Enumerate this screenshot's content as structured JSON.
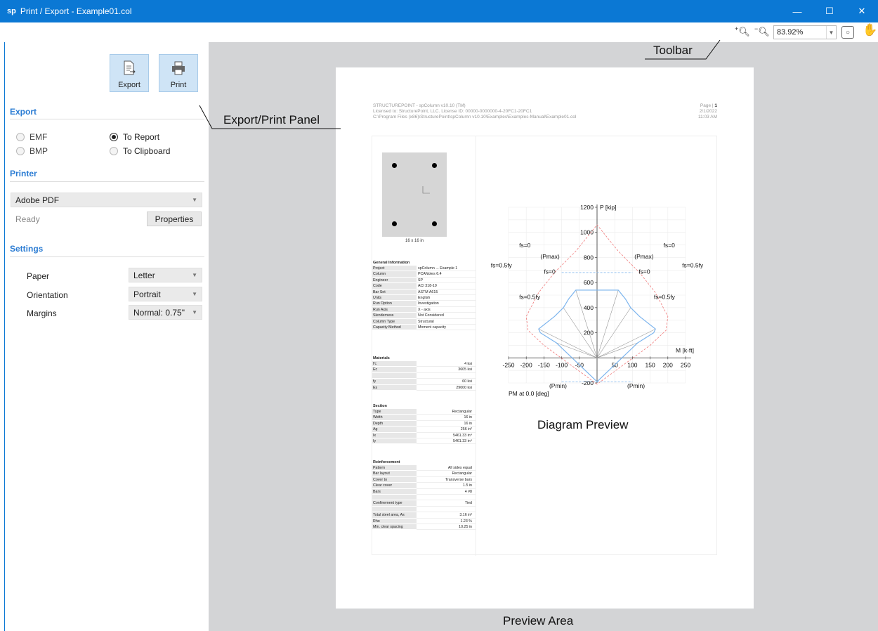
{
  "window": {
    "logo": "sp",
    "title": "Print / Export - Example01.col"
  },
  "toolbar": {
    "zoom_value": "83.92%",
    "zoom_in_icon": "zoom-in-icon",
    "zoom_out_icon": "zoom-out-icon",
    "fit_icon": "fit-page-icon",
    "hand_icon": "hand-pan-icon"
  },
  "panel": {
    "export_button": "Export",
    "print_button": "Print",
    "export_section": "Export",
    "export_options": {
      "emf": "EMF",
      "bmp": "BMP",
      "to_report": "To Report",
      "to_clipboard": "To Clipboard"
    },
    "selected_target": "To Report",
    "printer_section": "Printer",
    "printer_name": "Adobe PDF",
    "printer_status": "Ready",
    "properties_button": "Properties",
    "settings_section": "Settings",
    "paper_label": "Paper",
    "paper_value": "Letter",
    "orientation_label": "Orientation",
    "orientation_value": "Portrait",
    "margins_label": "Margins",
    "margins_value": "Normal: 0.75\""
  },
  "page": {
    "header_line1": "STRUCTUREPOINT - spColumn v10.10 (TM)",
    "header_line2": "Licensed to: StructurePoint, LLC. License ID: 00000-0000000-4-20FC1-20FC1",
    "header_line3": "C:\\Program Files (x86)\\StructurePoint\\spColumn v10.10\\Examples\\Examples-Manual\\Example01.col",
    "page_label": "Page |",
    "page_num": "1",
    "date": "2/1/2022",
    "time": "11:03 AM",
    "section_dims": "16 x 16 in",
    "general": {
      "title": "General Information",
      "rows": [
        [
          "Project",
          "spColumn ... Example 1"
        ],
        [
          "Column",
          "PCANotes 6.4"
        ],
        [
          "Engineer",
          "SP"
        ],
        [
          "Code",
          "ACI 318-19"
        ],
        [
          "Bar Set",
          "ASTM A615"
        ],
        [
          "Units",
          "English"
        ],
        [
          "Run Option",
          "Investigation"
        ],
        [
          "Run Axis",
          "X - axis"
        ],
        [
          "Slenderness",
          "Not Considered"
        ],
        [
          "Column Type",
          "Structural"
        ],
        [
          "Capacity Method",
          "Moment capacity"
        ]
      ]
    },
    "materials": {
      "title": "Materials",
      "rows": [
        [
          "f'c",
          "4 ksi"
        ],
        [
          "Ec",
          "3605 ksi"
        ],
        [
          "",
          ""
        ],
        [
          "fy",
          "60 ksi"
        ],
        [
          "Es",
          "29000 ksi"
        ]
      ]
    },
    "section": {
      "title": "Section",
      "rows": [
        [
          "Type",
          "Rectangular"
        ],
        [
          "Width",
          "16 in"
        ],
        [
          "Depth",
          "16 in"
        ],
        [
          "Ag",
          "256 in²"
        ],
        [
          "Ix",
          "5461.33 in⁴"
        ],
        [
          "Iy",
          "5461.33 in⁴"
        ]
      ]
    },
    "reinforcement": {
      "title": "Reinforcement",
      "rows": [
        [
          "Pattern",
          "All sides equal"
        ],
        [
          "Bar layout",
          "Rectangular"
        ],
        [
          "Cover to",
          "Transverse bars"
        ],
        [
          "Clear cover",
          "1.5 in"
        ],
        [
          "Bars",
          "4 #8"
        ],
        [
          "",
          ""
        ],
        [
          "Confinement type",
          "Tied"
        ],
        [
          "",
          ""
        ],
        [
          "Total steel area, As",
          "3.16 in²"
        ],
        [
          "Rho",
          "1.23 %"
        ],
        [
          "Min. clear spacing",
          "10.25 in"
        ]
      ]
    }
  },
  "chart_data": {
    "type": "line",
    "xlabel": "M [k-ft]",
    "ylabel": "P [kip]",
    "xlim": [
      -250,
      250
    ],
    "ylim": [
      -200,
      1200
    ],
    "xticks": [
      -250,
      -200,
      -150,
      -100,
      -50,
      50,
      100,
      150,
      200,
      250
    ],
    "yticks": [
      -200,
      200,
      400,
      600,
      800,
      1000,
      1200
    ],
    "caption": "PM at 0.0 [deg]",
    "labels": {
      "fs0": "fs=0",
      "fs05": "fs=0.5fy",
      "pmax": "(Pmax)",
      "pmin": "(Pmin)"
    },
    "series": [
      {
        "values": [
          [
            0,
            -190
          ],
          [
            -115,
            120
          ],
          [
            -160,
            200
          ],
          [
            -165,
            230
          ],
          [
            -120,
            330
          ],
          [
            -95,
            400
          ],
          [
            -80,
            470
          ],
          [
            -60,
            540
          ],
          [
            0,
            540
          ],
          [
            60,
            540
          ],
          [
            80,
            470
          ],
          [
            95,
            400
          ],
          [
            120,
            330
          ],
          [
            165,
            230
          ],
          [
            160,
            200
          ],
          [
            115,
            120
          ],
          [
            0,
            -190
          ]
        ]
      },
      {
        "values": [
          [
            0,
            -210
          ],
          [
            -150,
            100
          ],
          [
            -195,
            220
          ],
          [
            -200,
            330
          ],
          [
            -165,
            520
          ],
          [
            -120,
            680
          ],
          [
            -60,
            850
          ],
          [
            0,
            1060
          ],
          [
            60,
            850
          ],
          [
            120,
            680
          ],
          [
            165,
            520
          ],
          [
            200,
            330
          ],
          [
            195,
            220
          ],
          [
            150,
            100
          ],
          [
            0,
            -210
          ]
        ]
      }
    ],
    "colors": {
      "design": "#7db5ee",
      "nominal": "#f07a7a",
      "spokes": "#999999"
    }
  },
  "annotations": {
    "toolbar": "Toolbar",
    "panel": "Export/Print Panel",
    "diagram": "Diagram Preview",
    "preview_area": "Preview Area"
  }
}
